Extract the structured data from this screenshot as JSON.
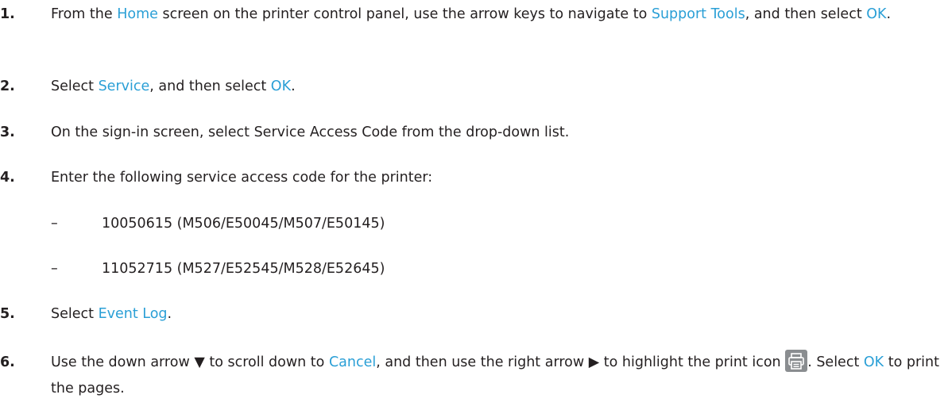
{
  "steps": [
    {
      "number": "1.",
      "parts": [
        {
          "text": "From the ",
          "link": false
        },
        {
          "text": "Home",
          "link": true
        },
        {
          "text": " screen on the printer control panel, use the arrow keys to navigate to ",
          "link": false
        },
        {
          "text": "Support Tools",
          "link": true
        },
        {
          "text": ", and then select ",
          "link": false
        },
        {
          "text": "OK",
          "link": true
        },
        {
          "text": ".",
          "link": false
        }
      ]
    },
    {
      "number": "2.",
      "parts": [
        {
          "text": "Select ",
          "link": false
        },
        {
          "text": "Service",
          "link": true
        },
        {
          "text": ", and then select ",
          "link": false
        },
        {
          "text": "OK",
          "link": true
        },
        {
          "text": ".",
          "link": false
        }
      ]
    },
    {
      "number": "3.",
      "parts": [
        {
          "text": "On the sign-in screen, select Service Access Code from the drop-down list.",
          "link": false
        }
      ]
    },
    {
      "number": "4.",
      "parts": [
        {
          "text": "Enter the following service access code for the printer:",
          "link": false
        }
      ]
    },
    {
      "number": "5.",
      "parts": [
        {
          "text": "Select ",
          "link": false
        },
        {
          "text": "Event Log",
          "link": true
        },
        {
          "text": ".",
          "link": false
        }
      ]
    },
    {
      "number": "6.",
      "parts": [
        {
          "text": "Use the down arrow ▼ to scroll down to ",
          "link": false
        },
        {
          "text": "Cancel",
          "link": true
        },
        {
          "text": ", and then use the right arrow ▶ to highlight the print icon ",
          "link": false
        },
        {
          "icon": "print-icon"
        },
        {
          "text": ". Select ",
          "link": false
        },
        {
          "text": "OK",
          "link": true
        },
        {
          "text": " to print the pages.",
          "link": false
        }
      ]
    }
  ],
  "codes": [
    {
      "dash": "–",
      "text": "10050615 (M506/E50045/M507/E50145)"
    },
    {
      "dash": "–",
      "text": "11052715 (M527/E52545/M528/E52645)"
    }
  ],
  "colors": {
    "link": "#2a9fd6",
    "text": "#231f20",
    "icon_bg": "#8a8d90"
  }
}
